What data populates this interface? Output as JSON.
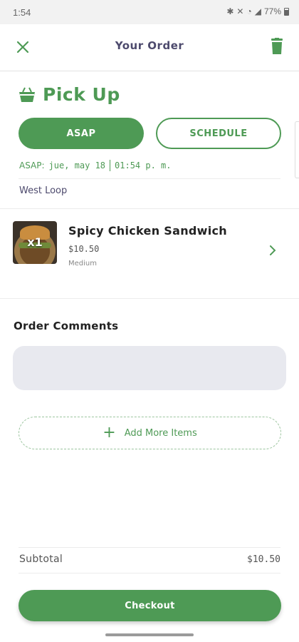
{
  "status_bar": {
    "time": "1:54",
    "battery": "77%"
  },
  "header": {
    "title": "Your Order"
  },
  "order_type": {
    "title": "Pick Up"
  },
  "timing": {
    "asap_label": "ASAP",
    "schedule_label": "SCHEDULE",
    "asap_prefix": "ASAP:",
    "date": "jue, may 18",
    "time": "01:54 p. m."
  },
  "location": "West Loop",
  "items": [
    {
      "qty": "x1",
      "name": "Spicy Chicken Sandwich",
      "price": "$10.50",
      "option": "Medium"
    }
  ],
  "comments": {
    "label": "Order Comments",
    "value": ""
  },
  "add_more": {
    "label": "Add More Items"
  },
  "summary": {
    "subtotal_label": "Subtotal",
    "subtotal_value": "$10.50"
  },
  "checkout": {
    "label": "Checkout"
  },
  "colors": {
    "accent": "#4e9a55",
    "title": "#4d4a6d",
    "input_bg": "#e8e9ef"
  }
}
